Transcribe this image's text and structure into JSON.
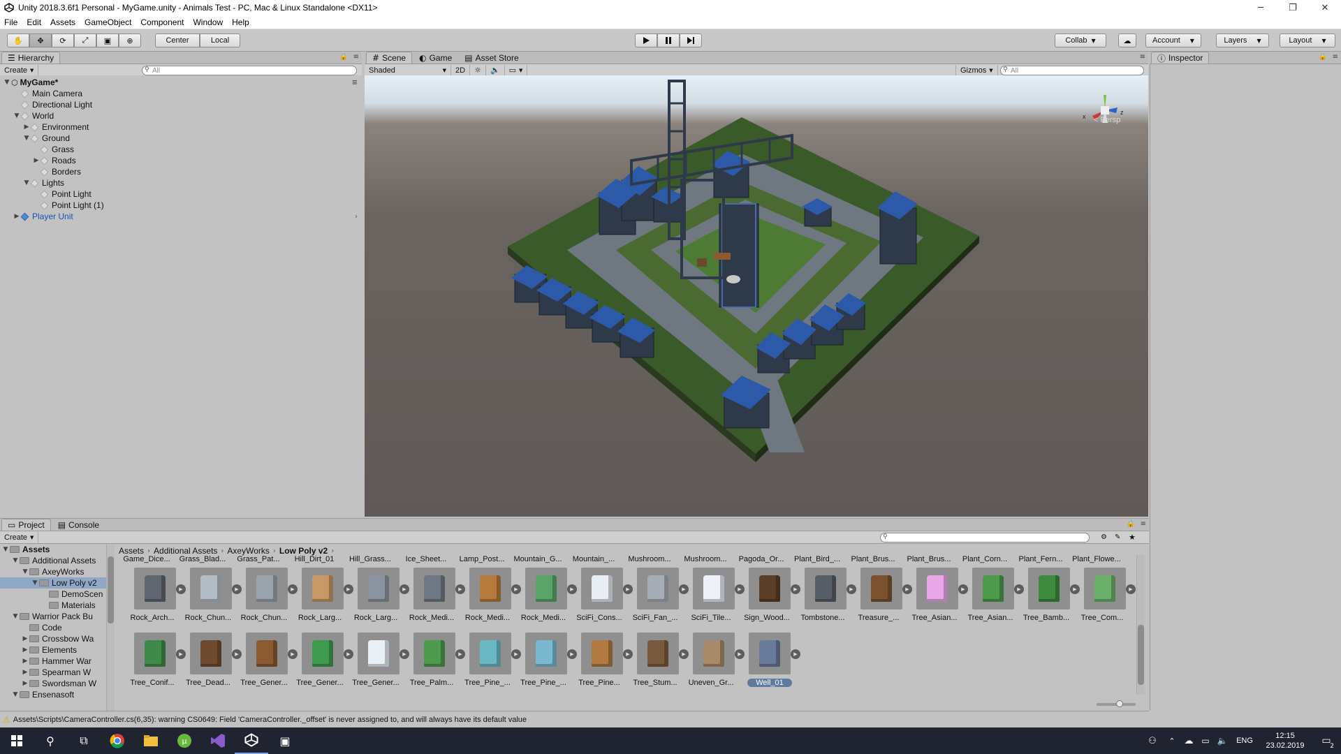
{
  "window": {
    "title": "Unity 2018.3.6f1 Personal - MyGame.unity - Animals Test - PC, Mac & Linux Standalone <DX11>",
    "minimize": "─",
    "restore": "❐",
    "close": "✕"
  },
  "menu": [
    "File",
    "Edit",
    "Assets",
    "GameObject",
    "Component",
    "Window",
    "Help"
  ],
  "toolbar": {
    "pivot_center": "Center",
    "pivot_local": "Local",
    "collab": "Collab",
    "account": "Account",
    "layers": "Layers",
    "layout": "Layout"
  },
  "hierarchy": {
    "tab": "Hierarchy",
    "create": "Create",
    "search_placeholder": "All",
    "scene": "MyGame*",
    "items": [
      {
        "label": "Main Camera",
        "depth": 1,
        "arrow": ""
      },
      {
        "label": "Directional Light",
        "depth": 1,
        "arrow": ""
      },
      {
        "label": "World",
        "depth": 1,
        "arrow": "▼"
      },
      {
        "label": "Environment",
        "depth": 2,
        "arrow": "▶"
      },
      {
        "label": "Ground",
        "depth": 2,
        "arrow": "▼"
      },
      {
        "label": "Grass",
        "depth": 3,
        "arrow": ""
      },
      {
        "label": "Roads",
        "depth": 3,
        "arrow": "▶"
      },
      {
        "label": "Borders",
        "depth": 3,
        "arrow": ""
      },
      {
        "label": "Lights",
        "depth": 2,
        "arrow": "▼"
      },
      {
        "label": "Point Light",
        "depth": 3,
        "arrow": ""
      },
      {
        "label": "Point Light (1)",
        "depth": 3,
        "arrow": ""
      },
      {
        "label": "Player Unit",
        "depth": 1,
        "arrow": "▶",
        "prefab": true
      }
    ]
  },
  "scene": {
    "tabs": [
      "Scene",
      "Game",
      "Asset Store"
    ],
    "shading": "Shaded",
    "mode_2d": "2D",
    "gizmos": "Gizmos",
    "search_placeholder": "All",
    "persp": "< Persp",
    "axis_x": "x",
    "axis_z": "z"
  },
  "inspector": {
    "tab": "Inspector"
  },
  "project": {
    "tabs": [
      "Project",
      "Console"
    ],
    "create": "Create",
    "tree": [
      {
        "label": "Assets",
        "depth": 0,
        "arrow": "▼",
        "bold": true
      },
      {
        "label": "Additional Assets",
        "depth": 1,
        "arrow": "▼"
      },
      {
        "label": "AxeyWorks",
        "depth": 2,
        "arrow": "▼"
      },
      {
        "label": "Low Poly v2",
        "depth": 3,
        "arrow": "▼",
        "selected": true
      },
      {
        "label": "DemoScen",
        "depth": 4,
        "arrow": ""
      },
      {
        "label": "Materials",
        "depth": 4,
        "arrow": ""
      },
      {
        "label": "Warrior Pack Bu",
        "depth": 1,
        "arrow": "▼"
      },
      {
        "label": "Code",
        "depth": 2,
        "arrow": ""
      },
      {
        "label": "Crossbow Wa",
        "depth": 2,
        "arrow": "▶"
      },
      {
        "label": "Elements",
        "depth": 2,
        "arrow": "▶"
      },
      {
        "label": "Hammer War",
        "depth": 2,
        "arrow": "▶"
      },
      {
        "label": "Spearman W",
        "depth": 2,
        "arrow": "▶"
      },
      {
        "label": "Swordsman W",
        "depth": 2,
        "arrow": "▶"
      },
      {
        "label": "Ensenasoft",
        "depth": 1,
        "arrow": "▼"
      }
    ],
    "breadcrumb": [
      "Assets",
      "Additional Assets",
      "AxeyWorks",
      "Low Poly v2"
    ],
    "top_names": [
      "Game_Dice...",
      "Grass_Blad...",
      "Grass_Pat...",
      "Hill_Dirt_01",
      "Hill_Grass...",
      "Ice_Sheet...",
      "Lamp_Post...",
      "Mountain_G...",
      "Mountain_...",
      "Mushroom...",
      "Mushroom...",
      "Pagoda_Or...",
      "Plant_Bird_...",
      "Plant_Brus...",
      "Plant_Brus...",
      "Plant_Corn...",
      "Plant_Fern...",
      "Plant_Flowe..."
    ],
    "row1": [
      {
        "name": "Rock_Arch...",
        "color": "#5f6670"
      },
      {
        "name": "Rock_Chun...",
        "color": "#b4bcc6"
      },
      {
        "name": "Rock_Chun...",
        "color": "#9aa2ac"
      },
      {
        "name": "Rock_Larg...",
        "color": "#c79866"
      },
      {
        "name": "Rock_Larg...",
        "color": "#8b93a0"
      },
      {
        "name": "Rock_Medi...",
        "color": "#6f7884"
      },
      {
        "name": "Rock_Medi...",
        "color": "#b67a3c"
      },
      {
        "name": "Rock_Medi...",
        "color": "#5aa46a"
      },
      {
        "name": "SciFi_Cons...",
        "color": "#e8eef4"
      },
      {
        "name": "SciFi_Fan_...",
        "color": "#a7adb4"
      },
      {
        "name": "SciFi_Tile...",
        "color": "#eef2f6"
      },
      {
        "name": "Sign_Wood...",
        "color": "#5a3e28"
      },
      {
        "name": "Tombstone...",
        "color": "#585e66"
      },
      {
        "name": "Treasure_...",
        "color": "#7a5230"
      },
      {
        "name": "Tree_Asian...",
        "color": "#e8a8e8"
      },
      {
        "name": "Tree_Asian...",
        "color": "#4d9a4d"
      },
      {
        "name": "Tree_Bamb...",
        "color": "#3e8a3e"
      },
      {
        "name": "Tree_Com...",
        "color": "#6ab06a"
      }
    ],
    "row2": [
      {
        "name": "Tree_Conif...",
        "color": "#3f8a4a"
      },
      {
        "name": "Tree_Dead...",
        "color": "#6e4a2e"
      },
      {
        "name": "Tree_Gener...",
        "color": "#8a5a30"
      },
      {
        "name": "Tree_Gener...",
        "color": "#3e9a4e"
      },
      {
        "name": "Tree_Gener...",
        "color": "#e8f0f4"
      },
      {
        "name": "Tree_Palm...",
        "color": "#4e9a4e"
      },
      {
        "name": "Tree_Pine_...",
        "color": "#6ab8c4"
      },
      {
        "name": "Tree_Pine_...",
        "color": "#7ab8d0"
      },
      {
        "name": "Tree_Pine...",
        "color": "#b07a40"
      },
      {
        "name": "Tree_Stum...",
        "color": "#7a5a3e"
      },
      {
        "name": "Uneven_Gr...",
        "color": "#a88a6a"
      },
      {
        "name": "Well_01",
        "color": "#6a7a9a",
        "selected": true
      }
    ]
  },
  "status": {
    "message": "Assets\\Scripts\\CameraController.cs(6,35): warning CS0649: Field 'CameraController._offset' is never assigned to, and will always have its default value"
  },
  "taskbar": {
    "lang": "ENG",
    "time": "12:15",
    "date": "23.02.2019",
    "notifications": "2"
  },
  "colors": {
    "unity_bg": "#c2c2c2",
    "selection": "#5f7c9f",
    "prefab_blue": "#1a52b8",
    "taskbar": "#1f2430"
  }
}
